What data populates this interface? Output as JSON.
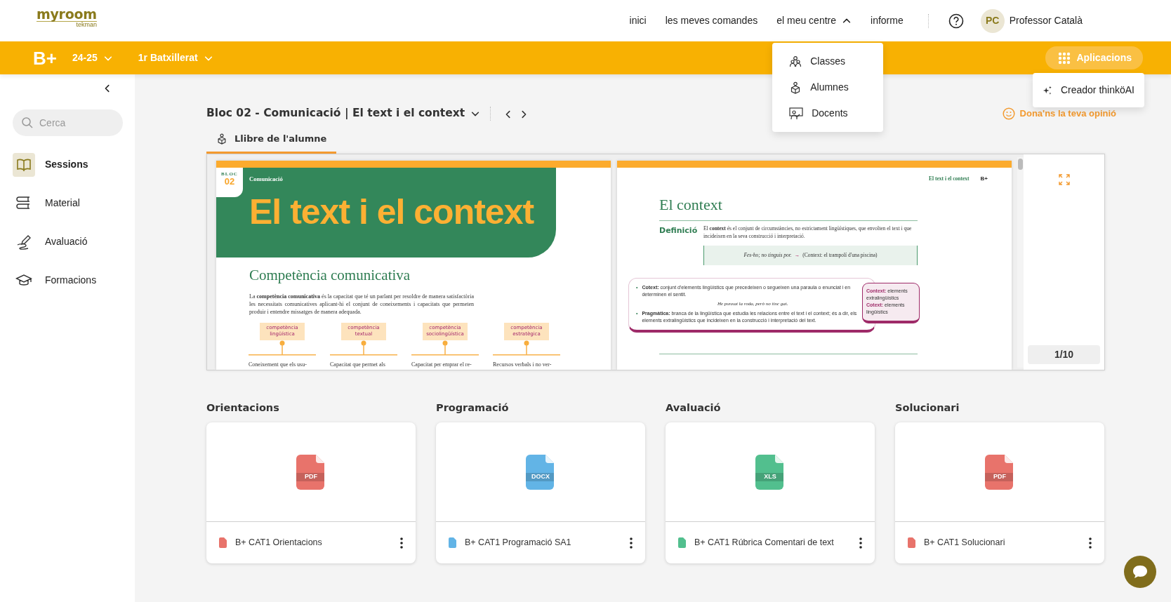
{
  "header": {
    "logo": "myroom",
    "logo_sub": "tekman",
    "nav": [
      {
        "label": "inici",
        "kind": "link"
      },
      {
        "label": "les meves comandes",
        "kind": "link"
      },
      {
        "label": "el meu centre",
        "kind": "dropdown",
        "expanded": true,
        "items": [
          {
            "label": "Classes",
            "kind": "classes"
          },
          {
            "label": "Alumnes",
            "kind": "students"
          },
          {
            "label": "Docents",
            "kind": "teachers"
          }
        ]
      },
      {
        "label": "informe",
        "kind": "link"
      }
    ],
    "user": {
      "initials": "PC",
      "name": "Professor Català"
    }
  },
  "toolbar": {
    "logo": "B+",
    "year": "24-25",
    "course": "1r Batxillerat",
    "apps": {
      "label": "Aplicacions",
      "expanded": true,
      "items": [
        "Creador thinköAI"
      ]
    }
  },
  "sidebar": {
    "search": {
      "placeholder": "Cerca"
    },
    "items": [
      {
        "label": "Sessions",
        "kind": "book",
        "selected": true
      },
      {
        "label": "Material",
        "kind": "stack",
        "selected": false
      },
      {
        "label": "Avaluació",
        "kind": "pen",
        "selected": false
      },
      {
        "label": "Formacions",
        "kind": "cap",
        "selected": false
      }
    ]
  },
  "main": {
    "title": "Bloc 02 - Comunicació | El text i el context",
    "feedback": "Dona'ns la teva opinió",
    "tabs": [
      {
        "label": "Llibre de l'alumne",
        "selected": true
      }
    ],
    "book": {
      "left_page": {
        "bloc_label": "BLOC",
        "bloc_number": "02",
        "section": "Comunicació",
        "title": "El text i el context",
        "heading": "Competència comunicativa",
        "intro": "La **competència comunicativa** és la capacitat que té un parlant per resoldre de manera satisfactòria les necessitats comunicatives aplicant-hi el conjunt de coneixements i capacitats que permeten produir i entendre missatges de manera adequada.",
        "competences": [
          {
            "label": "competència lingüística",
            "desc": "Coneixement que els usu-"
          },
          {
            "label": "competència textual",
            "desc": "Capacitat que permet als"
          },
          {
            "label": "competència sociolingüística",
            "desc": "Capacitat per emprar el re-"
          },
          {
            "label": "competència estratègica",
            "desc": "Recursos verbals i no ver-"
          }
        ]
      },
      "right_page": {
        "running_head": "El text i el context",
        "logo": "B+",
        "title": "El context",
        "definition_label": "Definició",
        "definition": "El **context** és el conjunt de circumstàncies, no estrictament lingüístiques, que envolten el text i que incideixen en la seva construcció i interpretació.",
        "example_phrase": "Fes-ho; no tinguis por.",
        "example_arrow": "→",
        "example_context": "(Context: el trampolí d'una piscina)",
        "bullets": [
          {
            "marker": "•",
            "text": "**Cotext:** conjunt d'elements lingüístics que precedeixen o segueixen una paraula o enunciat i en determinen el sentit.",
            "example": "He punxat la roda, però no tinc gat."
          },
          {
            "marker": "•",
            "text": "**Pragmàtica:** branca de la lingüística que estudia les relacions entre el text i el context; és a dir, els elements extralingüístics que incideixen en la construcció i interpretació del text."
          }
        ],
        "note": [
          "**Context:** elements extralingüístics",
          "**Cotext:** elements lingüístics"
        ]
      }
    },
    "page_counter": "1/10"
  },
  "sections": [
    {
      "heading": "Orientacions",
      "file": {
        "name": "B+ CAT1 Orientacions",
        "type": "PDF",
        "color": "#e8736b"
      }
    },
    {
      "heading": "Programació",
      "file": {
        "name": "B+ CAT1 Programació SA1",
        "type": "DOCX",
        "color": "#62b4e6"
      }
    },
    {
      "heading": "Avaluació",
      "file": {
        "name": "B+ CAT1 Rúbrica Comentari de text",
        "type": "XLS",
        "color": "#52bf8e"
      }
    },
    {
      "heading": "Solucionari",
      "file": {
        "name": "B+ CAT1 Solucionari",
        "type": "PDF",
        "color": "#e8736b"
      }
    }
  ]
}
